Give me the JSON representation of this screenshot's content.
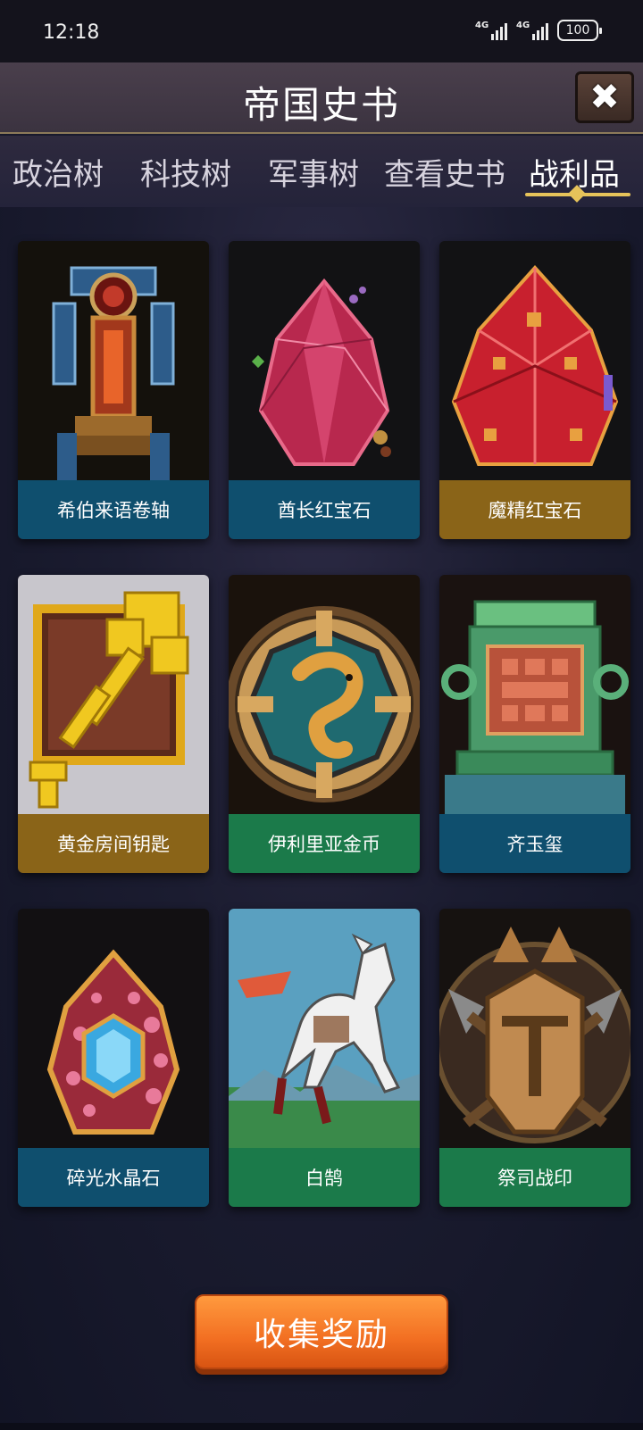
{
  "status_bar": {
    "time": "12:18",
    "network1": "4G",
    "network2": "4G",
    "battery": "100"
  },
  "header": {
    "title": "帝国史书",
    "close_label": "✖"
  },
  "tabs": [
    {
      "label": "政治树",
      "active": false
    },
    {
      "label": "科技树",
      "active": false
    },
    {
      "label": "军事树",
      "active": false
    },
    {
      "label": "查看史书",
      "active": false
    },
    {
      "label": "战利品",
      "active": true
    }
  ],
  "items": [
    {
      "name": "希伯来语卷轴",
      "icon": "scroll-icon",
      "label_color": "#0f4f6e"
    },
    {
      "name": "酋长红宝石",
      "icon": "ruby-icon",
      "label_color": "#0f4f6e"
    },
    {
      "name": "魔精红宝石",
      "icon": "ruby-icon",
      "label_color": "#8a6418"
    },
    {
      "name": "黄金房间钥匙",
      "icon": "golden-key-icon",
      "label_color": "#8a6418"
    },
    {
      "name": "伊利里亚金币",
      "icon": "coin-icon",
      "label_color": "#1b7a4a"
    },
    {
      "name": "齐玉玺",
      "icon": "jade-seal-icon",
      "label_color": "#0f4f6e"
    },
    {
      "name": "碎光水晶石",
      "icon": "crystal-icon",
      "label_color": "#0f4f6e"
    },
    {
      "name": "白鹄",
      "icon": "white-horse-icon",
      "label_color": "#1b7a4a"
    },
    {
      "name": "祭司战印",
      "icon": "war-seal-icon",
      "label_color": "#1b7a4a"
    }
  ],
  "collect_button": {
    "label": "收集奖励"
  }
}
